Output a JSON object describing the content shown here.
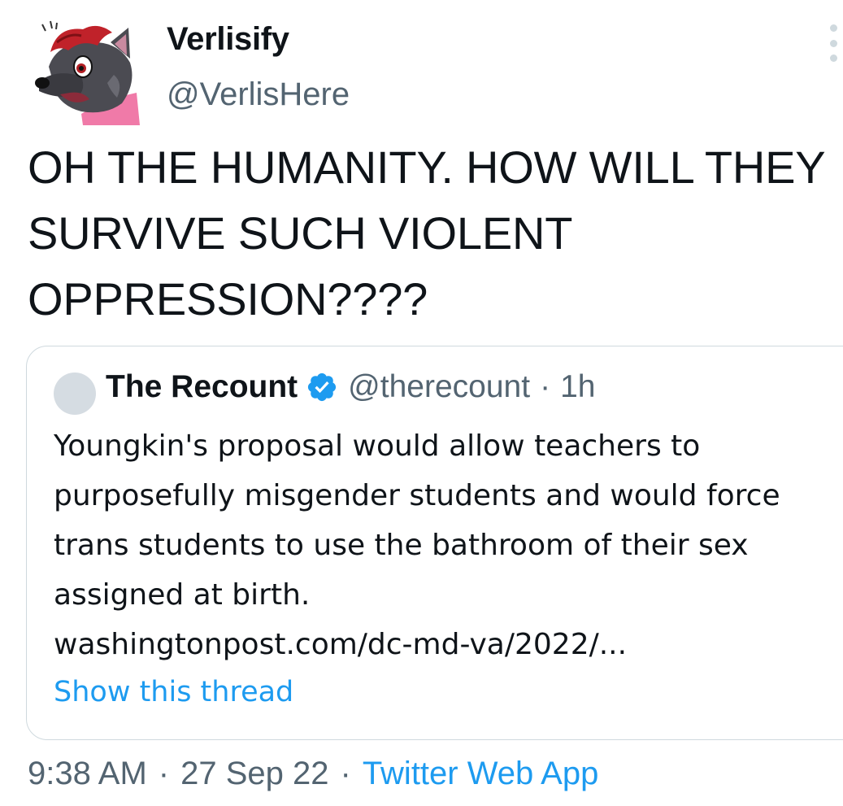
{
  "author": {
    "display_name": "Verlisify",
    "handle": "@VerlisHere",
    "avatar_icon": "wolf-character-avatar"
  },
  "tweet": {
    "text": "OH THE HUMANITY. HOW WILL THEY SURVIVE SUCH VIOLENT OPPRESSION????"
  },
  "quote": {
    "display_name": "The Recount",
    "verified_icon": "verified-badge-icon",
    "handle": "@therecount",
    "separator": "·",
    "time": "1h",
    "text": "Youngkin's proposal would allow teachers to purposefully misgender students and would force trans students to use the bathroom of their sex assigned at birth.",
    "link": "washingtonpost.com/dc-md-va/2022/...",
    "show_thread": "Show this thread"
  },
  "meta": {
    "time": "9:38 AM",
    "separator": "·",
    "date": "27 Sep 22",
    "source": "Twitter Web App"
  },
  "colors": {
    "link_blue": "#1d9bf0",
    "secondary_text": "#536471",
    "border": "#cfd9de"
  }
}
